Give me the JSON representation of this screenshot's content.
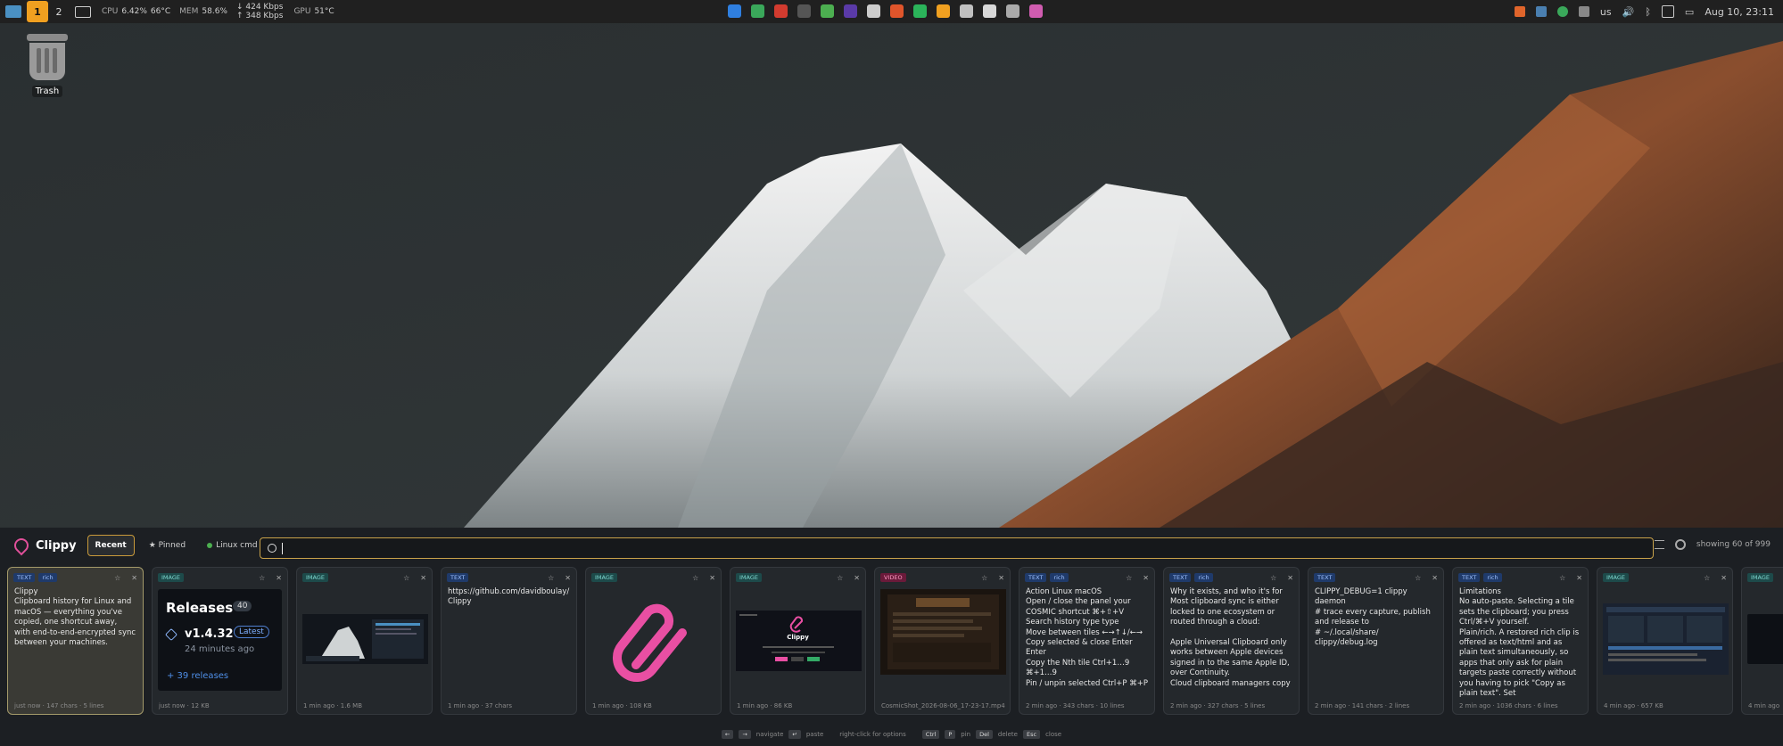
{
  "topbar": {
    "workspaces": [
      "1",
      "2"
    ],
    "cpu_label": "CPU",
    "cpu_value": "6.42%",
    "cpu_temp": "66°C",
    "mem_label": "MEM",
    "mem_value": "58.6%",
    "net_down": "↓ 424 Kbps",
    "net_up": "↑ 348 Kbps",
    "gpu_label": "GPU",
    "gpu_temp": "51°C",
    "app_icon_colors": [
      "#2f7fe0",
      "#3aa85a",
      "#d23b2f",
      "#555555",
      "#4caf50",
      "#5a3aa8",
      "#cccccc",
      "#e0552b",
      "#2bb45a",
      "#f0a020",
      "#c0c0c0",
      "#d8d8d8",
      "#aaaaaa",
      "#d05cb0"
    ],
    "keyboard_layout": "us",
    "datetime": "Aug 10, 23:11"
  },
  "desktop": {
    "trash_label": "Trash"
  },
  "clippy": {
    "title": "Clippy",
    "tabs": {
      "recent": "Recent",
      "pinned": "★ Pinned",
      "linux": "Linux cmd",
      "add": "+"
    },
    "search_value": "",
    "showing": "showing 60 of 999",
    "tiles": [
      {
        "badges": [
          "TEXT",
          "rich"
        ],
        "body": "Clippy\nClipboard history for Linux and macOS — everything you've copied, one shortcut away,\nwith end-to-end-encrypted sync between your machines.",
        "foot": "just now · 147 chars · 5 lines"
      },
      {
        "badges": [
          "IMAGE"
        ],
        "foot": "just now · 12 KB",
        "release_title": "Releases",
        "release_count": "40",
        "release_version": "v1.4.32",
        "release_latest": "Latest",
        "release_age": "24 minutes ago",
        "release_more": "+ 39 releases"
      },
      {
        "badges": [
          "IMAGE"
        ],
        "foot": "1 min ago · 1.6 MB"
      },
      {
        "badges": [
          "TEXT"
        ],
        "body": "https://github.com/davidboulay/\nClippy",
        "foot": "1 min ago · 37 chars"
      },
      {
        "badges": [
          "IMAGE"
        ],
        "foot": "1 min ago · 108 KB"
      },
      {
        "badges": [
          "IMAGE"
        ],
        "foot": "1 min ago · 86 KB",
        "shot_title": "Clippy"
      },
      {
        "badges": [
          "VIDEO"
        ],
        "foot": "CosmicShot_2026-08-06_17-23-17.mp4"
      },
      {
        "badges": [
          "TEXT",
          "rich"
        ],
        "body": "Action   Linux    macOS\nOpen / close the panel   your COSMIC shortcut    ⌘+⇧+V\nSearch history   type      type\nMove between tiles  ←→↑↓/←→\nCopy selected & close    Enter   Enter\nCopy the Nth tile      Ctrl+1…9   ⌘+1…9\nPin / unpin selected Ctrl+P   ⌘+P",
        "foot": "2 min ago · 343 chars · 10 lines"
      },
      {
        "badges": [
          "TEXT",
          "rich"
        ],
        "body": "Why it exists, and who it's for\nMost clipboard sync is either locked to one ecosystem or routed through a cloud:\n\nApple Universal Clipboard only works between Apple devices signed in to the same Apple ID, over Continuity.\nCloud clipboard managers copy",
        "foot": "2 min ago · 327 chars · 5 lines"
      },
      {
        "badges": [
          "TEXT"
        ],
        "body": "CLIPPY_DEBUG=1 clippy daemon\n# trace every capture, publish and release to\n                          # ~/.local/share/\nclippy/debug.log",
        "foot": "2 min ago · 141 chars · 2 lines"
      },
      {
        "badges": [
          "TEXT",
          "rich"
        ],
        "body": "Limitations\nNo auto-paste. Selecting a tile sets the clipboard; you press Ctrl/⌘+V yourself.\nPlain/rich. A restored rich clip is offered as text/html and as plain text simultaneously, so apps that only ask for plain targets paste correctly without you having to pick \"Copy as plain text\". Set",
        "foot": "2 min ago · 1036 chars · 6 lines"
      },
      {
        "badges": [
          "IMAGE"
        ],
        "foot": "4 min ago · 657 KB"
      },
      {
        "badges": [
          "IMAGE"
        ],
        "foot": "4 min ago"
      }
    ],
    "footer": {
      "nav": "navigate",
      "paste": "paste",
      "right_click": "right-click for options",
      "pin_keys": [
        "Ctrl",
        "P"
      ],
      "pin": "pin",
      "del_key": "Del",
      "del": "delete",
      "esc_key": "Esc",
      "close": "close",
      "arrow_keys": [
        "←",
        "→"
      ],
      "enter_key": "↵"
    }
  }
}
